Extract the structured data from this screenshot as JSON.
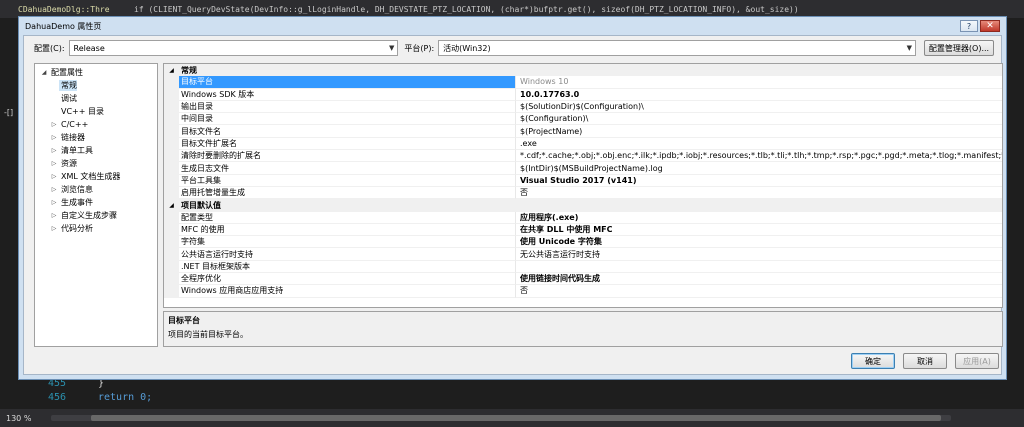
{
  "ide": {
    "class_dropdown": "CDahuaDemoDlg::Threac",
    "code_line": "if (CLIENT_QueryDevState(DevInfo::g_lLoginHandle, DH_DEVSTATE_PTZ_LOCATION, (char*)bufptr.get(), sizeof(DH_PTZ_LOCATION_INFO), &out_size))",
    "lines": [
      {
        "num": "455",
        "code": "}"
      },
      {
        "num": "456",
        "code": "return 0;"
      }
    ],
    "zoom": "130 %",
    "margin_marker": "-[]"
  },
  "dialog": {
    "title": "DahuaDemo 属性页",
    "help_btn": "?",
    "close_btn": "✕",
    "config_label": "配置(C):",
    "config_value": "Release",
    "platform_label": "平台(P):",
    "platform_value": "活动(Win32)",
    "config_manager_btn": "配置管理器(O)...",
    "tree": [
      {
        "label": "配置属性",
        "exp": "◢",
        "indent": 0
      },
      {
        "label": "常规",
        "exp": "",
        "indent": 1,
        "selected": true
      },
      {
        "label": "调试",
        "exp": "",
        "indent": 1
      },
      {
        "label": "VC++ 目录",
        "exp": "",
        "indent": 1
      },
      {
        "label": "C/C++",
        "exp": "▷",
        "indent": 1
      },
      {
        "label": "链接器",
        "exp": "▷",
        "indent": 1
      },
      {
        "label": "清单工具",
        "exp": "▷",
        "indent": 1
      },
      {
        "label": "资源",
        "exp": "▷",
        "indent": 1
      },
      {
        "label": "XML 文档生成器",
        "exp": "▷",
        "indent": 1
      },
      {
        "label": "浏览信息",
        "exp": "▷",
        "indent": 1
      },
      {
        "label": "生成事件",
        "exp": "▷",
        "indent": 1
      },
      {
        "label": "自定义生成步骤",
        "exp": "▷",
        "indent": 1
      },
      {
        "label": "代码分析",
        "exp": "▷",
        "indent": 1
      }
    ],
    "grid": [
      {
        "type": "cat",
        "name": "常规"
      },
      {
        "name": "目标平台",
        "value": "Windows 10",
        "selected": true
      },
      {
        "name": "Windows SDK 版本",
        "value": "10.0.17763.0",
        "bold": true
      },
      {
        "name": "输出目录",
        "value": "$(SolutionDir)$(Configuration)\\"
      },
      {
        "name": "中间目录",
        "value": "$(Configuration)\\"
      },
      {
        "name": "目标文件名",
        "value": "$(ProjectName)"
      },
      {
        "name": "目标文件扩展名",
        "value": ".exe"
      },
      {
        "name": "清除时要删除的扩展名",
        "value": "*.cdf;*.cache;*.obj;*.obj.enc;*.ilk;*.ipdb;*.iobj;*.resources;*.tlb;*.tli;*.tlh;*.tmp;*.rsp;*.pgc;*.pgd;*.meta;*.tlog;*.manifest;*.res;*.pch;*.exp"
      },
      {
        "name": "生成日志文件",
        "value": "$(IntDir)$(MSBuildProjectName).log"
      },
      {
        "name": "平台工具集",
        "value": "Visual Studio 2017 (v141)",
        "bold": true
      },
      {
        "name": "启用托管增量生成",
        "value": "否"
      },
      {
        "type": "cat",
        "name": "项目默认值"
      },
      {
        "name": "配置类型",
        "value": "应用程序(.exe)",
        "bold": true
      },
      {
        "name": "MFC 的使用",
        "value": "在共享 DLL 中使用 MFC",
        "bold": true
      },
      {
        "name": "字符集",
        "value": "使用 Unicode 字符集",
        "bold": true
      },
      {
        "name": "公共语言运行时支持",
        "value": "无公共语言运行时支持"
      },
      {
        "name": ".NET 目标框架版本",
        "value": ""
      },
      {
        "name": "全程序优化",
        "value": "使用链接时间代码生成",
        "bold": true
      },
      {
        "name": "Windows 应用商店应用支持",
        "value": "否"
      }
    ],
    "desc_title": "目标平台",
    "desc_text": "项目的当前目标平台。",
    "ok_btn": "确定",
    "cancel_btn": "取消",
    "apply_btn": "应用(A)"
  }
}
